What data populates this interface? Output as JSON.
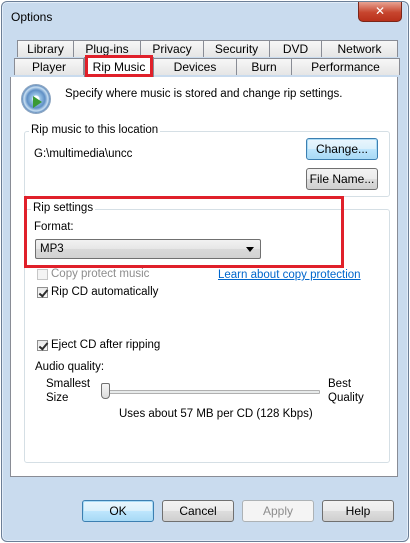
{
  "window": {
    "title": "Options",
    "close_glyph": "✕"
  },
  "tabs_row1": [
    "Library",
    "Plug-ins",
    "Privacy",
    "Security",
    "DVD",
    "Network"
  ],
  "tabs_row2": [
    "Player",
    "Rip Music",
    "Devices",
    "Burn",
    "Performance"
  ],
  "active_tab": "Rip Music",
  "header": {
    "icon": "rip-cd-icon",
    "description": "Specify where music is stored and change rip settings."
  },
  "location": {
    "group_label": "Rip music to this location",
    "path": "G:\\multimedia\\uncc",
    "change_button": "Change...",
    "filename_button": "File Name..."
  },
  "rip_settings": {
    "group_label": "Rip settings",
    "format_label": "Format:",
    "format_value": "MP3",
    "copy_protect_label": "Copy protect music",
    "copy_protect_checked": false,
    "copy_protect_enabled": false,
    "learn_link": "Learn about copy protection",
    "rip_auto_label": "Rip CD automatically",
    "rip_auto_checked": true,
    "eject_label": "Eject CD after ripping",
    "eject_checked": true,
    "audio_quality_label": "Audio quality:",
    "slider_min_label_1": "Smallest",
    "slider_min_label_2": "Size",
    "slider_max_label_1": "Best",
    "slider_max_label_2": "Quality",
    "quality_level": 0,
    "usage_text": "Uses about 57 MB per CD (128 Kbps)"
  },
  "buttons": {
    "ok": "OK",
    "cancel": "Cancel",
    "apply": "Apply",
    "help": "Help"
  },
  "colors": {
    "highlight": "#e0202a",
    "link": "#0066cc",
    "frame": "#c9dbee"
  }
}
